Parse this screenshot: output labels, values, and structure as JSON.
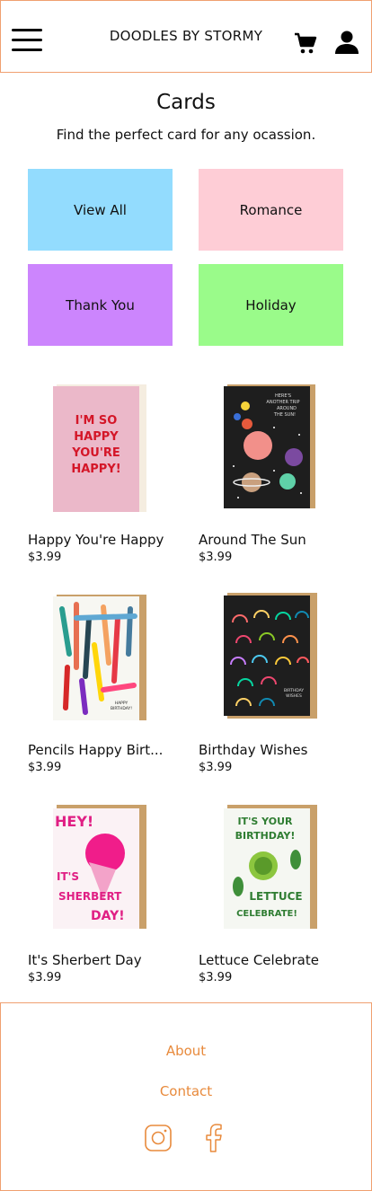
{
  "header": {
    "brand": "DOODLES BY STORMY",
    "menu_icon": "hamburger-menu-icon",
    "cart_icon": "shopping-cart-icon",
    "account_icon": "user-account-icon"
  },
  "page": {
    "title": "Cards",
    "subtitle": "Find the perfect card for any ocassion."
  },
  "categories": [
    {
      "label": "View All",
      "color": "#93dcfe"
    },
    {
      "label": "Romance",
      "color": "#fecdd6"
    },
    {
      "label": "Thank You",
      "color": "#cc85fd"
    },
    {
      "label": "Holiday",
      "color": "#9afb8a"
    }
  ],
  "products": [
    {
      "name": "Happy You're Happy",
      "price": "$3.99",
      "card_text": [
        "I'M SO",
        "HAPPY",
        "YOU'RE",
        "HAPPY!"
      ]
    },
    {
      "name": "Around The Sun",
      "price": "$3.99",
      "card_text": [
        "HERE'S",
        "ANOTHER TRIP",
        "AROUND",
        "THE SUN!"
      ]
    },
    {
      "name": "Pencils Happy Birt...",
      "price": "$3.99",
      "card_text": [
        "HAPPY",
        "BIRTHDAY!"
      ]
    },
    {
      "name": "Birthday Wishes",
      "price": "$3.99",
      "card_text": [
        "BIRTHDAY",
        "WISHES"
      ]
    },
    {
      "name": "It's Sherbert Day",
      "price": "$3.99",
      "card_text": [
        "HEY!",
        "IT'S",
        "SHERBERT",
        "DAY!"
      ]
    },
    {
      "name": "Lettuce Celebrate",
      "price": "$3.99",
      "card_text": [
        "IT'S YOUR",
        "BIRTHDAY!",
        "LETTUCE",
        "CELEBRATE!"
      ]
    }
  ],
  "footer": {
    "about": "About",
    "contact": "Contact",
    "social_icons": [
      "instagram-icon",
      "facebook-icon"
    ],
    "accent": "#e88a3c"
  }
}
